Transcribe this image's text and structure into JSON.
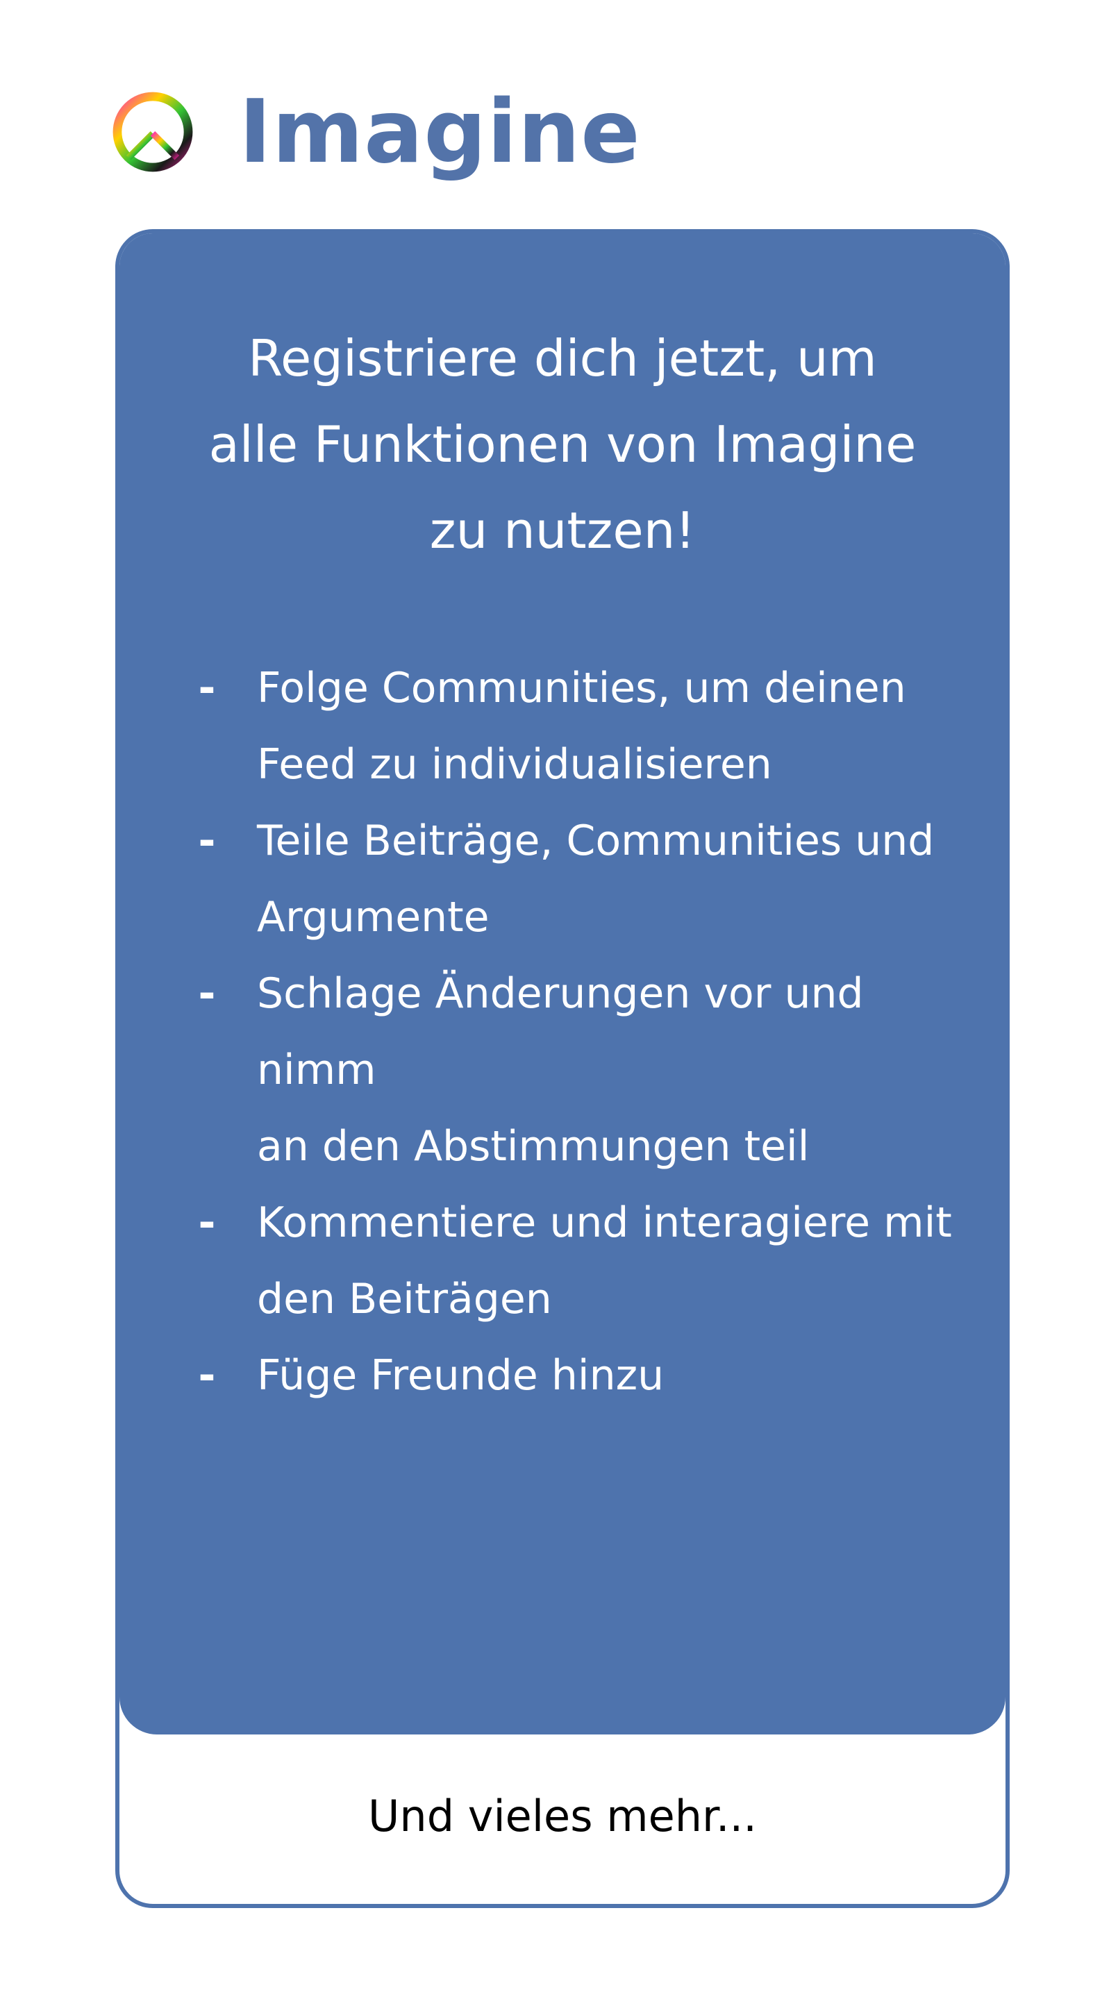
{
  "app": {
    "title": "Imagine",
    "logo_icon": "peace-sign-icon"
  },
  "colors": {
    "brand": "#4e73ad",
    "title": "#5373a9",
    "text_on_brand": "#ffffff"
  },
  "card": {
    "headline_lines": [
      "Registriere dich jetzt, um",
      "alle Funktionen von Imagine",
      "zu nutzen!"
    ],
    "bullet_marker": "-",
    "features": [
      {
        "lines": [
          "Folge Communities, um deinen",
          "Feed zu individualisieren"
        ]
      },
      {
        "lines": [
          "Teile Beiträge, Communities und",
          "Argumente"
        ]
      },
      {
        "lines": [
          "Schlage Änderungen vor und nimm",
          "an den Abstimmungen teil"
        ]
      },
      {
        "lines": [
          "Kommentiere und interagiere mit",
          "den Beiträgen"
        ]
      },
      {
        "lines": [
          "Füge Freunde hinzu"
        ]
      }
    ],
    "footer": "Und vieles mehr..."
  }
}
